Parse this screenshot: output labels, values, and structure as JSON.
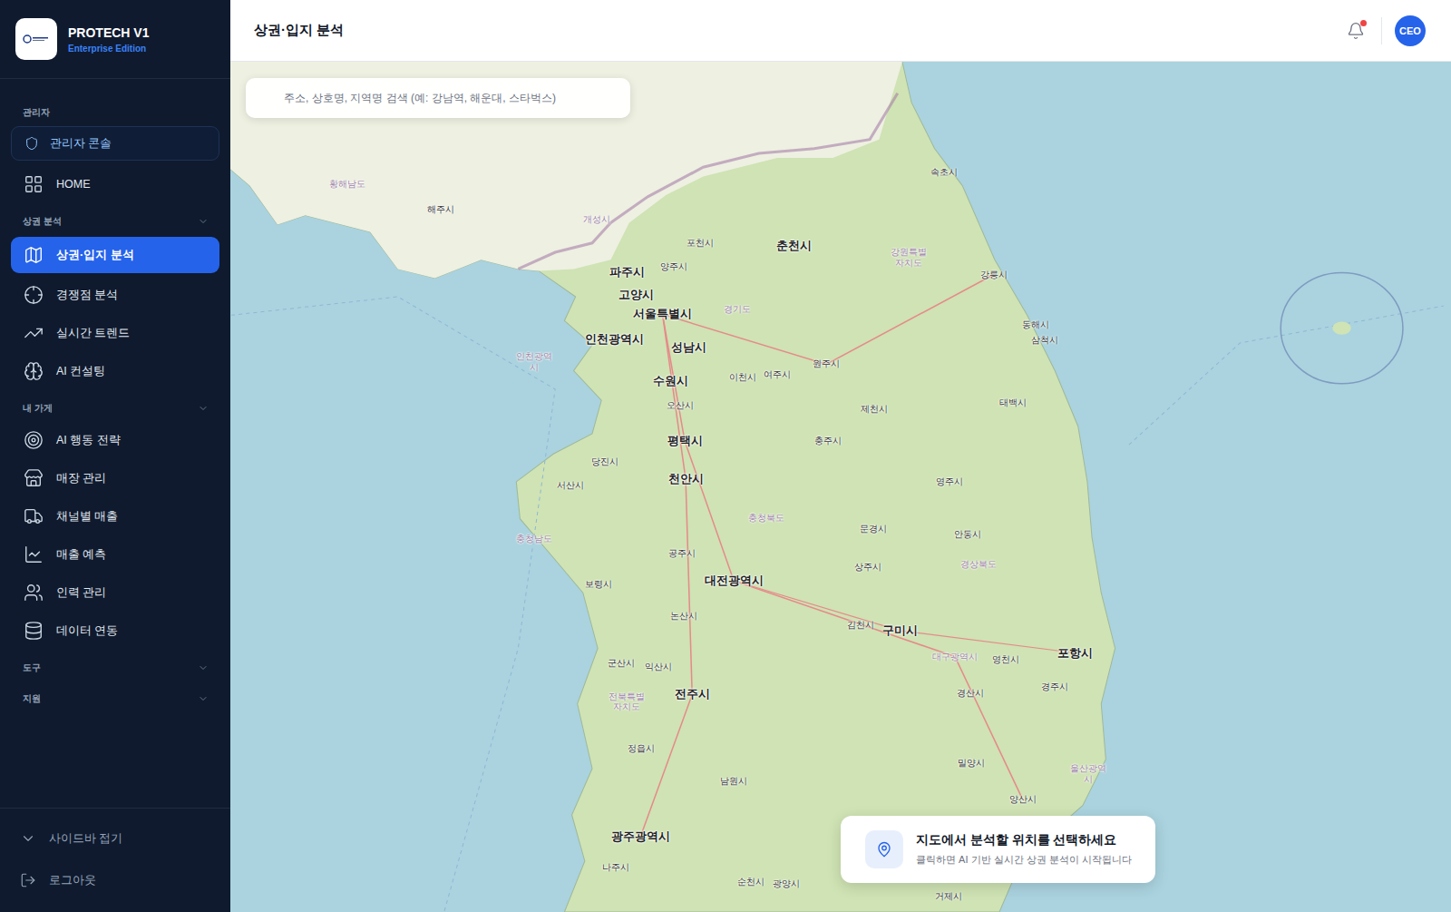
{
  "app": {
    "name": "PROTECH V1",
    "edition": "Enterprise Edition"
  },
  "header": {
    "title": "상권·입지 분석",
    "notification_unread": true,
    "avatar": "CEO"
  },
  "sidebar": {
    "sections": [
      {
        "label": "관리자",
        "collapsible": false,
        "items": [
          {
            "label": "관리자 콘솔",
            "kind": "outlined",
            "selected": false
          },
          {
            "label": "HOME",
            "kind": "plain",
            "selected": false
          }
        ]
      },
      {
        "label": "상권 분석",
        "collapsible": true,
        "items": [
          {
            "label": "상권·입지 분석",
            "kind": "plain",
            "selected": true
          },
          {
            "label": "경쟁점 분석",
            "kind": "plain",
            "selected": false
          },
          {
            "label": "실시간 트렌드",
            "kind": "plain",
            "selected": false
          },
          {
            "label": "AI 컨설팅",
            "kind": "plain",
            "selected": false
          }
        ]
      },
      {
        "label": "내 가게",
        "collapsible": true,
        "items": [
          {
            "label": "AI 행동 전략",
            "kind": "plain",
            "selected": false
          },
          {
            "label": "매장 관리",
            "kind": "plain",
            "selected": false
          },
          {
            "label": "채널별 매출",
            "kind": "plain",
            "selected": false
          },
          {
            "label": "매출 예측",
            "kind": "plain",
            "selected": false
          },
          {
            "label": "인력 관리",
            "kind": "plain",
            "selected": false
          },
          {
            "label": "데이터 연동",
            "kind": "plain",
            "selected": false
          }
        ]
      },
      {
        "label": "도구",
        "collapsible": true,
        "items": []
      },
      {
        "label": "지원",
        "collapsible": true,
        "items": []
      }
    ],
    "footer": [
      {
        "label": "사이드바 접기"
      },
      {
        "label": "로그아웃"
      }
    ]
  },
  "search": {
    "placeholder": "주소, 상호명, 지역명 검색 (예: 강남역, 해운대, 스타벅스)"
  },
  "map": {
    "labels": [
      {
        "text": "황해남도",
        "kind": "region"
      },
      {
        "text": "해주시",
        "kind": "minor"
      },
      {
        "text": "개성시",
        "kind": "region"
      },
      {
        "text": "속초시",
        "kind": "minor"
      },
      {
        "text": "포천시",
        "kind": "minor"
      },
      {
        "text": "춘천시",
        "kind": "major"
      },
      {
        "text": "강원특별자치도",
        "kind": "area"
      },
      {
        "text": "파주시",
        "kind": "major"
      },
      {
        "text": "양주시",
        "kind": "minor"
      },
      {
        "text": "강릉시",
        "kind": "minor"
      },
      {
        "text": "고양시",
        "kind": "major"
      },
      {
        "text": "서울특별시",
        "kind": "major"
      },
      {
        "text": "경기도",
        "kind": "region"
      },
      {
        "text": "인천광역시",
        "kind": "major"
      },
      {
        "text": "성남시",
        "kind": "major"
      },
      {
        "text": "동해시",
        "kind": "minor"
      },
      {
        "text": "삼척시",
        "kind": "minor"
      },
      {
        "text": "원주시",
        "kind": "minor"
      },
      {
        "text": "인천광역시",
        "kind": "area"
      },
      {
        "text": "수원시",
        "kind": "major"
      },
      {
        "text": "이천시",
        "kind": "minor"
      },
      {
        "text": "여주시",
        "kind": "minor"
      },
      {
        "text": "오산시",
        "kind": "minor"
      },
      {
        "text": "제천시",
        "kind": "minor"
      },
      {
        "text": "태백시",
        "kind": "minor"
      },
      {
        "text": "평택시",
        "kind": "major"
      },
      {
        "text": "충주시",
        "kind": "minor"
      },
      {
        "text": "당진시",
        "kind": "minor"
      },
      {
        "text": "서산시",
        "kind": "minor"
      },
      {
        "text": "천안시",
        "kind": "major"
      },
      {
        "text": "영주시",
        "kind": "minor"
      },
      {
        "text": "충청북도",
        "kind": "region"
      },
      {
        "text": "충청남도",
        "kind": "region"
      },
      {
        "text": "문경시",
        "kind": "minor"
      },
      {
        "text": "안동시",
        "kind": "minor"
      },
      {
        "text": "공주시",
        "kind": "minor"
      },
      {
        "text": "상주시",
        "kind": "minor"
      },
      {
        "text": "경상북도",
        "kind": "region"
      },
      {
        "text": "보령시",
        "kind": "minor"
      },
      {
        "text": "대전광역시",
        "kind": "major"
      },
      {
        "text": "논산시",
        "kind": "minor"
      },
      {
        "text": "김천시",
        "kind": "minor"
      },
      {
        "text": "구미시",
        "kind": "major"
      },
      {
        "text": "포항시",
        "kind": "major"
      },
      {
        "text": "대구광역시",
        "kind": "region"
      },
      {
        "text": "영천시",
        "kind": "minor"
      },
      {
        "text": "군산시",
        "kind": "minor"
      },
      {
        "text": "익산시",
        "kind": "minor"
      },
      {
        "text": "경산시",
        "kind": "minor"
      },
      {
        "text": "경주시",
        "kind": "minor"
      },
      {
        "text": "전북특별자치도",
        "kind": "area"
      },
      {
        "text": "전주시",
        "kind": "major"
      },
      {
        "text": "정읍시",
        "kind": "minor"
      },
      {
        "text": "밀양시",
        "kind": "minor"
      },
      {
        "text": "울산광역시",
        "kind": "area"
      },
      {
        "text": "남원시",
        "kind": "minor"
      },
      {
        "text": "양산시",
        "kind": "minor"
      },
      {
        "text": "광주광역시",
        "kind": "major"
      },
      {
        "text": "나주시",
        "kind": "minor"
      },
      {
        "text": "순천시",
        "kind": "minor"
      },
      {
        "text": "광양시",
        "kind": "minor"
      },
      {
        "text": "거제시",
        "kind": "minor"
      }
    ]
  },
  "hint": {
    "title": "지도에서 분석할 위치를 선택하세요",
    "subtitle": "클릭하면 AI 기반 실시간 상권 분석이 시작됩니다"
  }
}
